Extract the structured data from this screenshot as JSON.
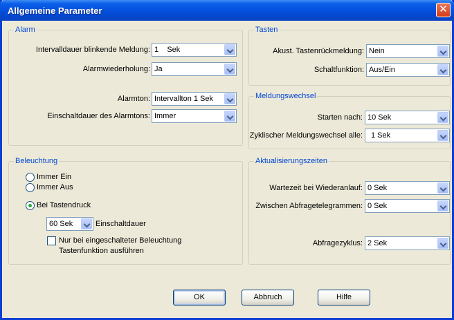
{
  "window": {
    "title": "Allgemeine Parameter",
    "close_glyph": "✕"
  },
  "alarm": {
    "legend": "Alarm",
    "interval_label": "Intervalldauer blinkende Meldung:",
    "interval_value": "1    Sek",
    "repeat_label": "Alarmwiederholung:",
    "repeat_value": "Ja",
    "tone_label": "Alarmton:",
    "tone_value": "Intervallton 1  Sek",
    "duration_label": "Einschaltdauer des Alarmtons:",
    "duration_value": "Immer"
  },
  "tasten": {
    "legend": "Tasten",
    "feedback_label": "Akust. Tastenrückmeldung:",
    "feedback_value": "Nein",
    "switch_label": "Schaltfunktion:",
    "switch_value": "Aus/Ein"
  },
  "meldungswechsel": {
    "legend": "Meldungswechsel",
    "start_label": "Starten nach:",
    "start_value": "10 Sek",
    "cycle_label": "Zyklischer Meldungswechsel alle:",
    "cycle_value": "1 Sek"
  },
  "beleuchtung": {
    "legend": "Beleuchtung",
    "radio_on": "Immer Ein",
    "radio_off": "Immer Aus",
    "radio_key": "Bei Tastendruck",
    "selected": "Bei Tastendruck",
    "duration_value": "60 Sek",
    "duration_label": "Einschaltdauer",
    "checkbox_line1": "Nur bei eingeschalteter Beleuchtung",
    "checkbox_line2": "Tastenfunktion ausführen",
    "checkbox_checked": false
  },
  "aktualisierung": {
    "legend": "Aktualisierungszeiten",
    "wait_label": "Wartezeit bei Wiederanlauf:",
    "wait_value": "0 Sek",
    "between_label": "Zwischen Abfragetelegrammen:",
    "between_value": "0 Sek",
    "cycle_label": "Abfragezyklus:",
    "cycle_value": "2 Sek"
  },
  "buttons": {
    "ok": "OK",
    "cancel": "Abbruch",
    "help": "Hilfe"
  }
}
